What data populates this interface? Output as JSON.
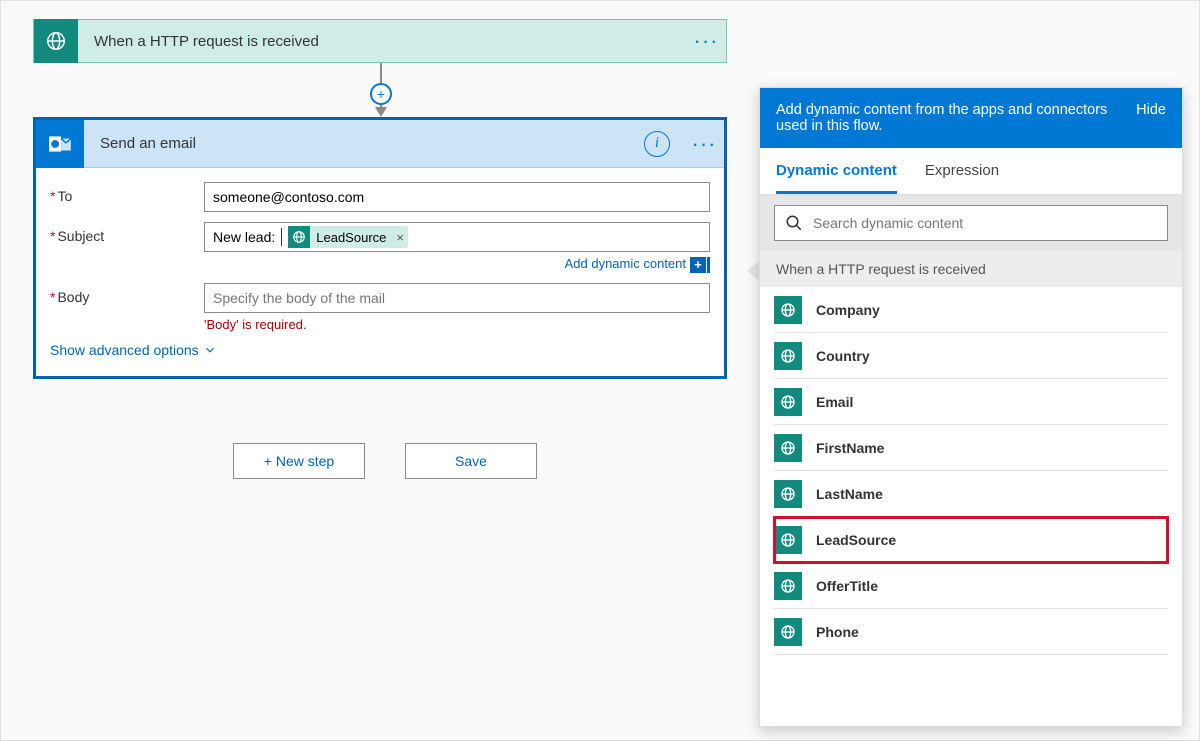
{
  "trigger": {
    "title": "When a HTTP request is received"
  },
  "action": {
    "title": "Send an email",
    "fields": {
      "to_label": "To",
      "to_value": "someone@contoso.com",
      "subject_label": "Subject",
      "subject_prefix": "New lead:",
      "subject_token": "LeadSource",
      "body_label": "Body",
      "body_placeholder": "Specify the body of the mail",
      "body_error": "'Body' is required."
    },
    "add_dc": "Add dynamic content",
    "advanced": "Show advanced options"
  },
  "buttons": {
    "new_step": "+ New step",
    "save": "Save"
  },
  "dc": {
    "banner": "Add dynamic content from the apps and connectors used in this flow.",
    "hide": "Hide",
    "tab_dynamic": "Dynamic content",
    "tab_expr": "Expression",
    "search_placeholder": "Search dynamic content",
    "section": "When a HTTP request is received",
    "items": [
      "Company",
      "Country",
      "Email",
      "FirstName",
      "LastName",
      "LeadSource",
      "OfferTitle",
      "Phone"
    ],
    "highlight_index": 5
  }
}
